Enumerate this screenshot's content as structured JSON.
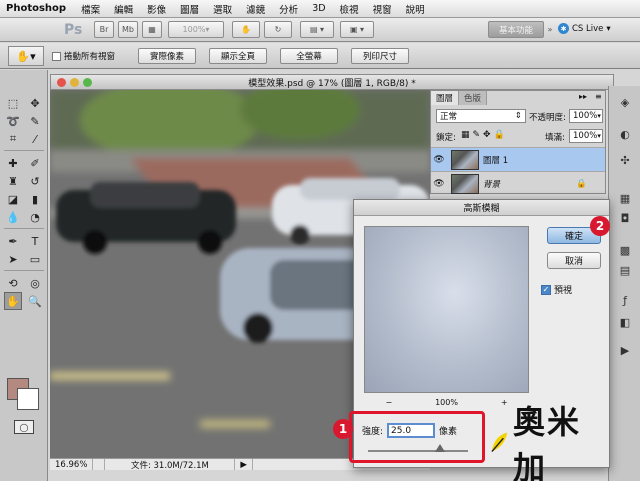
{
  "menubar": {
    "app_name": "Photoshop",
    "items": [
      "檔案",
      "編輯",
      "影像",
      "圖層",
      "選取",
      "濾鏡",
      "分析",
      "3D",
      "檢視",
      "視窗",
      "說明"
    ]
  },
  "appbar": {
    "logo": "Ps",
    "br_label": "Br",
    "mb_label": "Mb",
    "zoom": "100%",
    "workspace": "基本功能",
    "cs_live": "CS Live"
  },
  "options": {
    "scroll_all_windows": "捲動所有視窗",
    "actual_pixels": "實際像素",
    "fit_screen": "顯示全頁",
    "fill_screen": "全螢幕",
    "print_size": "列印尺寸"
  },
  "document": {
    "title": "模型效果.psd @ 17% (圖層 1, RGB/8) *",
    "zoom": "16.96%",
    "file_info": "文件: 31.0M/72.1M"
  },
  "layers_panel": {
    "tab_layers": "圖層",
    "tab_channels": "色版",
    "blend_mode": "正常",
    "opacity_label": "不透明度:",
    "opacity_value": "100%",
    "lock_label": "鎖定:",
    "fill_label": "填滿:",
    "fill_value": "100%",
    "layers": [
      {
        "name": "圖層 1",
        "selected": true
      },
      {
        "name": "背景",
        "selected": false
      }
    ]
  },
  "dialog": {
    "title": "高斯模糊",
    "ok": "確定",
    "cancel": "取消",
    "preview_label": "預視",
    "zoom_minus": "−",
    "zoom_value": "100%",
    "zoom_plus": "+",
    "radius_label": "強度:",
    "radius_value": "25.0",
    "radius_unit": "像素"
  },
  "annotations": {
    "badge_1": "1",
    "badge_2": "2"
  },
  "watermark": "奧米加",
  "colors": {
    "foreground": "#b48a80",
    "background": "#ffffff",
    "accent_red": "#d8182f",
    "selected_layer": "#a9c8ef"
  },
  "icons": {
    "hand_tool": "hand-icon",
    "eye": "eye-icon",
    "lock": "lock-icon"
  }
}
